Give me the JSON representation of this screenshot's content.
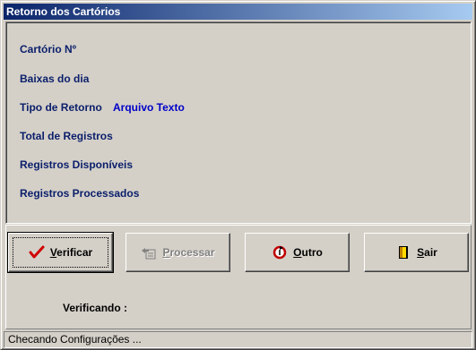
{
  "window": {
    "title": "Retorno dos Cartórios"
  },
  "fields": {
    "cartorio_label": "Cartório Nº",
    "baixas_label": "Baixas do dia",
    "tipo_label": "Tipo de Retorno",
    "tipo_value": "Arquivo Texto",
    "total_label": "Total de Registros",
    "disponiveis_label": "Registros Disponíveis",
    "processados_label": "Registros Processados"
  },
  "buttons": {
    "verificar": {
      "mnemonic": "V",
      "rest": "erificar",
      "enabled": true,
      "icon": "check-icon"
    },
    "processar": {
      "mnemonic": "P",
      "rest": "rocessar",
      "enabled": false,
      "icon": "process-icon"
    },
    "outro": {
      "mnemonic": "O",
      "rest": "utro",
      "enabled": true,
      "icon": "refresh-icon"
    },
    "sair": {
      "mnemonic": "S",
      "rest": "air",
      "enabled": true,
      "icon": "exit-door-icon"
    }
  },
  "progress": {
    "label": "Verificando :"
  },
  "status": {
    "text": "Checando Configurações ..."
  },
  "colors": {
    "label": "#0a1e6a",
    "value": "#0000c8",
    "title_bar": "#0a246a"
  }
}
